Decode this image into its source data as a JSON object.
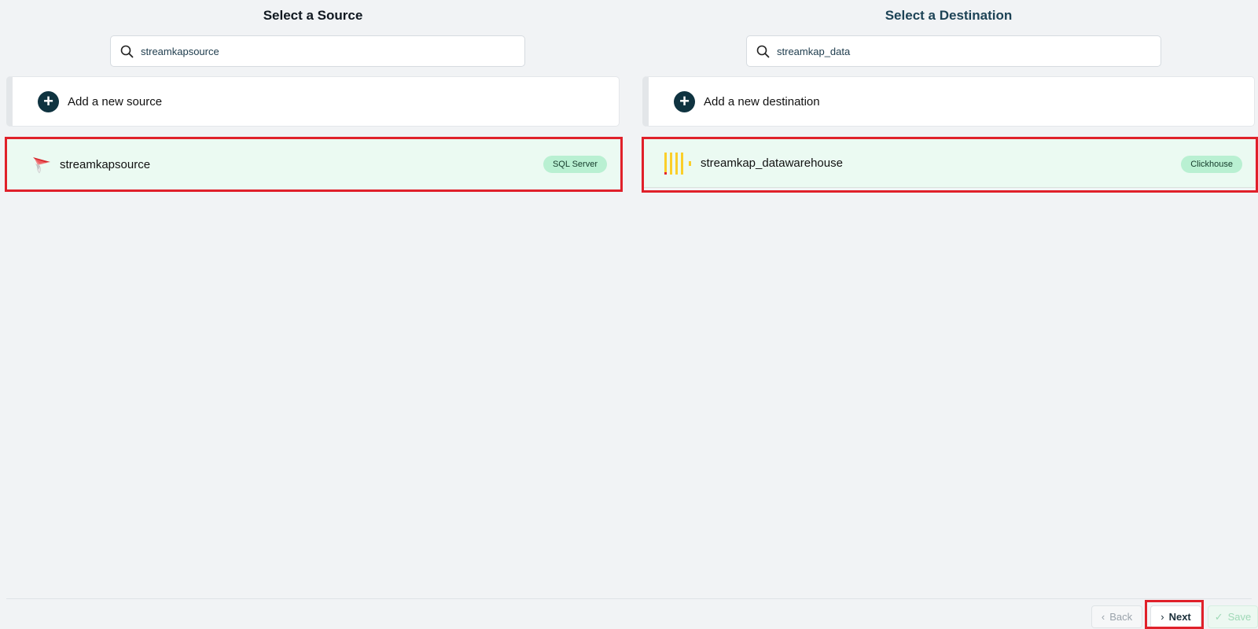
{
  "source": {
    "title": "Select a Source",
    "search_value": "streamkapsource",
    "add_label": "Add a new source",
    "item": {
      "name": "streamkapsource",
      "badge": "SQL Server",
      "icon": "sql-server-icon"
    }
  },
  "destination": {
    "title": "Select a Destination",
    "search_value": "streamkap_data",
    "add_label": "Add a new destination",
    "item": {
      "name": "streamkap_datawarehouse",
      "badge": "Clickhouse",
      "icon": "clickhouse-icon"
    }
  },
  "footer": {
    "back_label": "Back",
    "next_label": "Next",
    "save_label": "Save"
  },
  "colors": {
    "highlight": "#e0202a",
    "selected_bg": "#ebfaf2",
    "badge_bg": "#b9f0d2",
    "primary_dark": "#0f3340"
  }
}
